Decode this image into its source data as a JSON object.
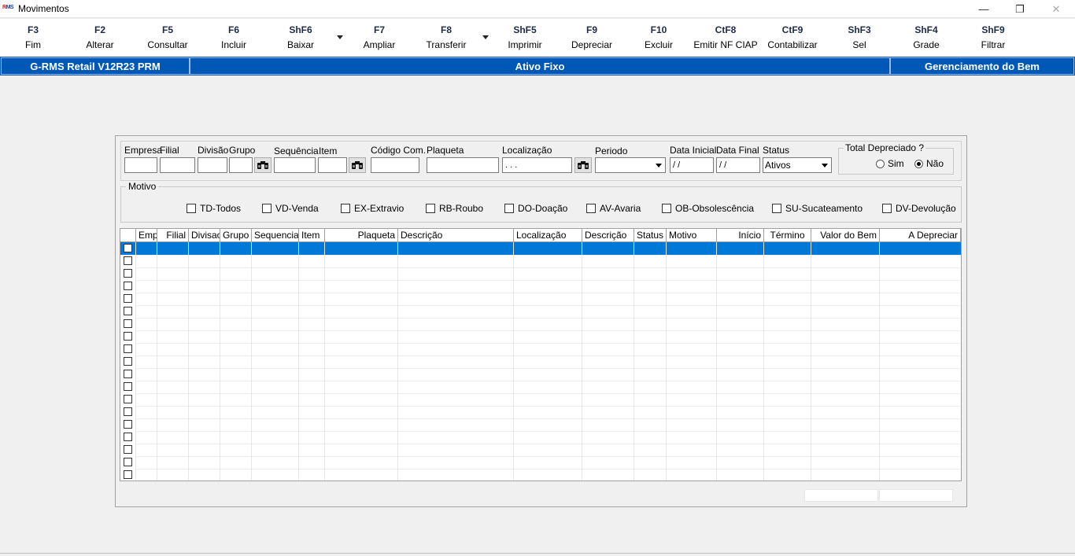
{
  "window": {
    "title": "Movimentos",
    "logo_prefix": "R",
    "logo_suffix": "MS",
    "minimize": "—",
    "restore": "❐",
    "close": "✕"
  },
  "toolbar": [
    {
      "key": "F3",
      "label": "Fim"
    },
    {
      "key": "F2",
      "label": "Alterar"
    },
    {
      "key": "F5",
      "label": "Consultar"
    },
    {
      "key": "F6",
      "label": "Incluir"
    },
    {
      "key": "ShF6",
      "label": "Baixar"
    },
    {
      "key": "F7",
      "label": "Ampliar"
    },
    {
      "key": "F8",
      "label": "Transferir"
    },
    {
      "key": "ShF5",
      "label": "Imprimir"
    },
    {
      "key": "F9",
      "label": "Depreciar"
    },
    {
      "key": "F10",
      "label": "Excluir"
    },
    {
      "key": "CtF8",
      "label": "Emitir NF CIAP"
    },
    {
      "key": "CtF9",
      "label": "Contabilizar"
    },
    {
      "key": "ShF3",
      "label": "Sel"
    },
    {
      "key": "ShF4",
      "label": "Grade"
    },
    {
      "key": "ShF9",
      "label": "Filtrar"
    }
  ],
  "banner": {
    "left": "G-RMS Retail V12R23 PRM",
    "center": "Ativo Fixo",
    "right": "Gerenciamento do Bem",
    "color": "#0058b6"
  },
  "filters": {
    "empresa": "Empresa",
    "filial": "Filial",
    "divisao": "Divisão",
    "grupo": "Grupo",
    "sequencia": "Sequência",
    "item": "Item",
    "codigo_com": "Código Com.",
    "plaqueta": "Plaqueta",
    "localizacao": "Localização",
    "localizacao_value": " .   .   . ",
    "periodo": "Periodo",
    "data_inicial": "Data Inicial",
    "data_final": "Data Final",
    "data_inicial_value": " / /",
    "data_final_value": " / /",
    "status": "Status",
    "status_value": "Ativos"
  },
  "total_depreciado": {
    "legend": "Total Depreciado ?",
    "sim": "Sim",
    "nao": "Não",
    "selected": "nao"
  },
  "motivo": {
    "legend": "Motivo",
    "options": [
      "TD-Todos",
      "VD-Venda",
      "EX-Extravio",
      "RB-Roubo",
      "DO-Doação",
      "AV-Avaria",
      "OB-Obsolescência",
      "SU-Sucateamento",
      "DV-Devolução"
    ]
  },
  "grid": {
    "columns": [
      "Emp",
      "Filial",
      "Divisao",
      "Grupo",
      "Sequencia",
      "Item",
      "Plaqueta",
      "Descrição",
      "Localização",
      "Descrição",
      "Status",
      "Motivo",
      "Início",
      "Término",
      "Valor do Bem",
      "A Depreciar"
    ],
    "row_count": 19,
    "selected_row": 0,
    "selection_color": "#0078d7"
  }
}
